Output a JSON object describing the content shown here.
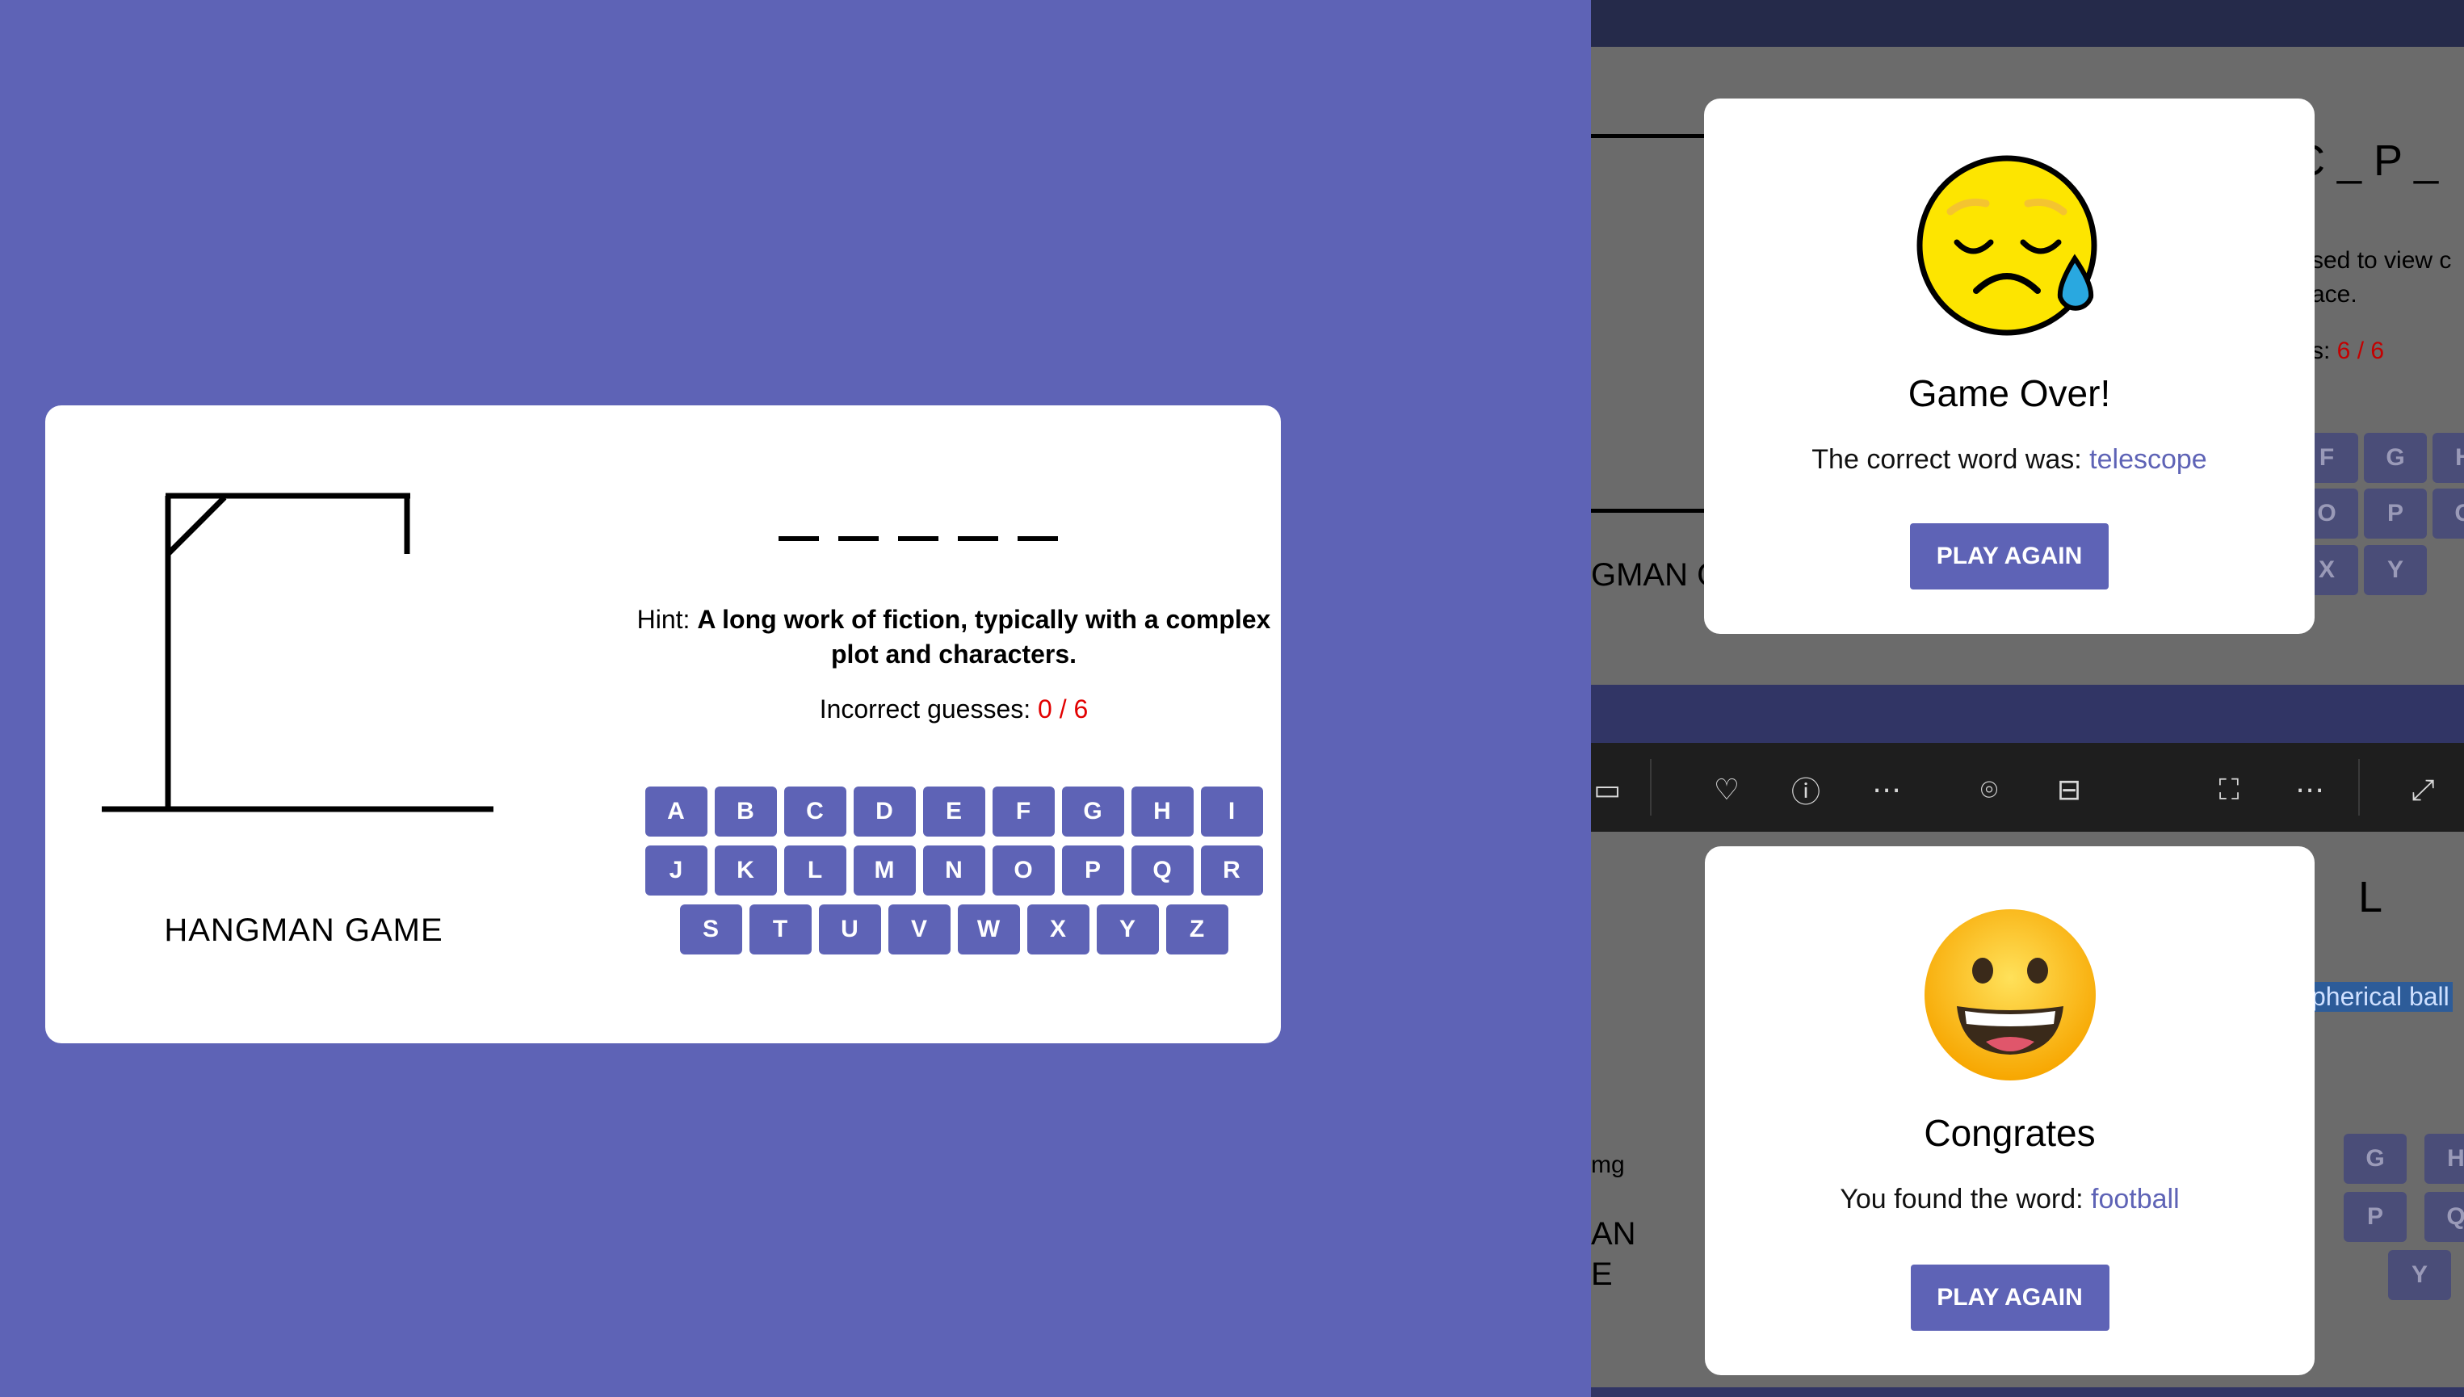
{
  "game": {
    "title": "HANGMAN GAME",
    "word_slot_count": 5,
    "hint_label": "Hint: ",
    "hint_text": "A long work of fiction, typically with a complex plot and characters.",
    "guesses_label": "Incorrect guesses: ",
    "guesses_count": "0 / 6",
    "keyboard_rows": [
      [
        "A",
        "B",
        "C",
        "D",
        "E",
        "F",
        "G",
        "H",
        "I"
      ],
      [
        "J",
        "K",
        "L",
        "M",
        "N",
        "O",
        "P",
        "Q",
        "R"
      ],
      [
        "S",
        "T",
        "U",
        "V",
        "W",
        "X",
        "Y",
        "Z"
      ]
    ]
  },
  "background_window": {
    "word_fragment": "C _ P _",
    "hint_fragment_1": "sed to view c",
    "hint_fragment_2": "ace.",
    "guesses_fragment_label": "s: ",
    "guesses_fragment_count": "6 / 6",
    "title_fragment": "GMAN G",
    "keys_top": [
      "F",
      "G",
      "H",
      "O",
      "P",
      "G",
      "X",
      "Y"
    ],
    "word_fragment_2": "L",
    "hint_fragment_3": "pherical ball",
    "img_label": "mg",
    "title_fragment_2a": "AN",
    "title_fragment_2b": "E",
    "keys_bottom": [
      "G",
      "H",
      "P",
      "Q",
      "Y"
    ]
  },
  "toolbar_icons": [
    "slideshow-icon",
    "heart-icon",
    "info-icon",
    "more-icon",
    "visual-search-icon",
    "text-scan-icon",
    "fullscreen-icon",
    "more-icon",
    "expand-icon"
  ],
  "dialog_lose": {
    "title": "Game Over!",
    "text": "The correct word was: ",
    "word": "telescope",
    "button": "PLAY AGAIN"
  },
  "dialog_win": {
    "title": "Congrates",
    "text": "You found the word: ",
    "word": "football",
    "button": "PLAY AGAIN"
  },
  "colors": {
    "accent": "#5e63b6",
    "error": "#e20000",
    "background": "#5e63b6"
  }
}
